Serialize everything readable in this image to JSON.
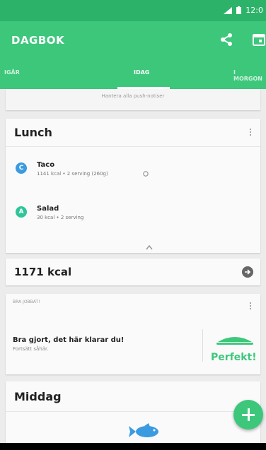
{
  "status_bar": {
    "time": "12:0"
  },
  "app_bar": {
    "title": "DAGBOK"
  },
  "tabs": [
    {
      "label": "IGÅR"
    },
    {
      "label": "IDAG"
    },
    {
      "label": "I MORGON"
    }
  ],
  "push_card": {
    "link": "Hantera alla push-notiser"
  },
  "lunch": {
    "title": "Lunch",
    "items": [
      {
        "badge": "C",
        "name": "Taco",
        "meta": "1141 kcal • 2 serving (260g)"
      },
      {
        "badge": "A",
        "name": "Salad",
        "meta": "30 kcal • 2 serving"
      }
    ]
  },
  "kcal": {
    "value": "1171 kcal"
  },
  "score": {
    "label": "BRA JOBBAT!",
    "heading": "Bra gjort, det här klarar du!",
    "subtext": "Fortsätt såhär.",
    "rating": "Perfekt!"
  },
  "middag": {
    "title": "Middag"
  },
  "colors": {
    "primary": "#3dc77b",
    "status": "#2db369",
    "badge_c": "#3b9be0",
    "badge_a": "#2ec59a"
  }
}
